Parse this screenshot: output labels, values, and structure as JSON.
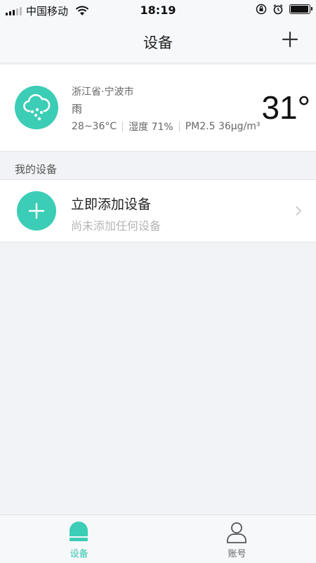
{
  "status_bar": {
    "carrier": "中国移动",
    "time": "18:19",
    "battery_level": 0.9
  },
  "nav": {
    "title": "设备"
  },
  "weather": {
    "location": "浙江省·宁波市",
    "condition": "雨",
    "temp_range": "28~36°C",
    "humidity": "湿度 71%",
    "pm25": "PM2.5 36μg/m³",
    "temperature": "31°"
  },
  "devices_section": {
    "label": "我的设备"
  },
  "add_device": {
    "title": "立即添加设备",
    "subtitle": "尚未添加任何设备"
  },
  "tabs": [
    {
      "label": "设备",
      "active": true
    },
    {
      "label": "账号",
      "active": false
    }
  ],
  "colors": {
    "accent": "#3ccdb6",
    "tab_active": "#2fc4ad",
    "background": "#f1f3f6"
  }
}
